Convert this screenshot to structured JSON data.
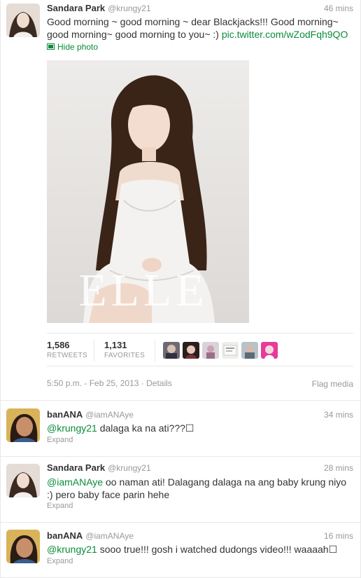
{
  "main_tweet": {
    "fullname": "Sandara Park",
    "username": "@krungy21",
    "time": "46 mins",
    "text_prefix": "Good morning ~ good morning ~ dear Blackjacks!!! Good morning~ good morning~ good morning to you~ :) ",
    "link": "pic.twitter.com/wZodFqh9QO",
    "hide_photo_label": "Hide photo",
    "photo_caption": "ELLE",
    "retweets": "1,586",
    "retweets_label": "RETWEETS",
    "favorites": "1,131",
    "favorites_label": "FAVORITES",
    "timestamp": "5:50 p.m. - Feb 25, 2013",
    "details_label": "Details",
    "separator": "·",
    "flag_label": "Flag media"
  },
  "replies": [
    {
      "fullname": "banANA",
      "username": "@iamANAye",
      "time": "34 mins",
      "mention": "@krungy21",
      "text": " dalaga ka na ati???☐",
      "expand": "Expand"
    },
    {
      "fullname": "Sandara Park",
      "username": "@krungy21",
      "time": "28 mins",
      "mention": "@iamANAye",
      "text": " oo naman ati! Dalagang dalaga na ang baby krung niyo :) pero baby face parin hehe",
      "expand": "Expand"
    },
    {
      "fullname": "banANA",
      "username": "@iamANAye",
      "time": "16 mins",
      "mention": "@krungy21",
      "text": " sooo true!!! gosh i watched dudongs video!!! waaaah☐",
      "expand": "Expand"
    }
  ],
  "colors": {
    "link": "#0a8c3a",
    "muted": "#999999",
    "border": "#e8e8e8"
  }
}
